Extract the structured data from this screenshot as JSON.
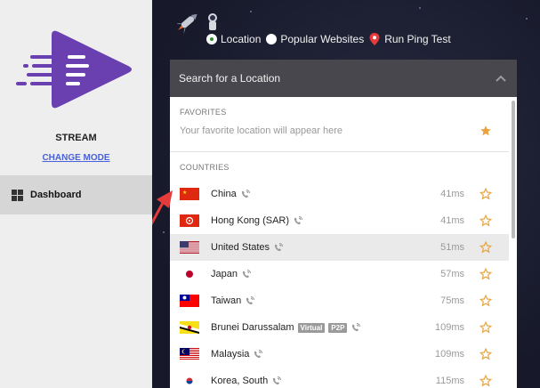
{
  "sidebar": {
    "mode_title": "STREAM",
    "change_mode_label": "CHANGE MODE",
    "nav": [
      {
        "label": "Dashboard",
        "icon": "dashboard-grid-icon",
        "active": true
      }
    ]
  },
  "tabs": [
    {
      "label": "Location",
      "selected": true
    },
    {
      "label": "Popular Websites",
      "selected": false
    },
    {
      "label": "Run Ping Test",
      "icon": "location-pin-icon"
    }
  ],
  "panel": {
    "title": "Search for a Location",
    "favorites_label": "FAVORITES",
    "favorites_placeholder": "Your favorite location will appear here",
    "countries_label": "COUNTRIES",
    "countries": [
      {
        "name": "China",
        "ping": "41ms",
        "flag": "cn",
        "badges": []
      },
      {
        "name": "Hong Kong (SAR)",
        "ping": "41ms",
        "flag": "hk",
        "badges": []
      },
      {
        "name": "United States",
        "ping": "51ms",
        "flag": "us",
        "badges": [],
        "highlighted": true
      },
      {
        "name": "Japan",
        "ping": "57ms",
        "flag": "jp",
        "badges": []
      },
      {
        "name": "Taiwan",
        "ping": "75ms",
        "flag": "tw",
        "badges": []
      },
      {
        "name": "Brunei Darussalam",
        "ping": "109ms",
        "flag": "bn",
        "badges": [
          "Virtual",
          "P2P"
        ]
      },
      {
        "name": "Malaysia",
        "ping": "109ms",
        "flag": "my",
        "badges": []
      },
      {
        "name": "Korea, South",
        "ping": "115ms",
        "flag": "kr",
        "badges": []
      }
    ]
  },
  "colors": {
    "sidebar_bg": "#eeeeee",
    "main_bg": "#1c1f2e",
    "panel_header": "#47474d",
    "accent_purple": "#6a3fb0",
    "star_gold": "#e8a33d",
    "link_blue": "#4a62d8",
    "arrow_red": "#e63b3b"
  }
}
